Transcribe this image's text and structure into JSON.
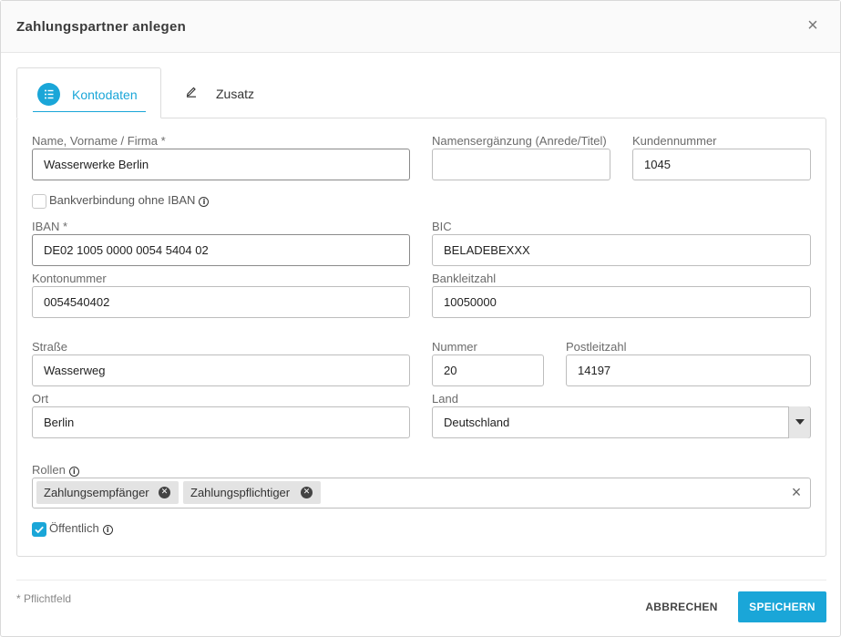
{
  "dialog": {
    "title": "Zahlungspartner anlegen",
    "close_symbol": "×"
  },
  "tabs": [
    {
      "label": "Kontodaten",
      "icon": "list-icon",
      "active": true
    },
    {
      "label": "Zusatz",
      "icon": "pencil-icon",
      "active": false
    }
  ],
  "form": {
    "name": {
      "label": "Name, Vorname / Firma *",
      "value": "Wasserwerke Berlin"
    },
    "name_addition": {
      "label": "Namensergänzung (Anrede/Titel)",
      "value": ""
    },
    "customer_number": {
      "label": "Kundennummer",
      "value": "1045"
    },
    "no_iban": {
      "label": "Bankverbindung ohne IBAN",
      "checked": false
    },
    "iban": {
      "label": "IBAN *",
      "value": "DE02 1005 0000 0054 5404 02"
    },
    "bic": {
      "label": "BIC",
      "value": "BELADEBEXXX"
    },
    "account_number": {
      "label": "Kontonummer",
      "value": "0054540402"
    },
    "bank_code": {
      "label": "Bankleitzahl",
      "value": "10050000"
    },
    "street": {
      "label": "Straße",
      "value": "Wasserweg"
    },
    "house_number": {
      "label": "Nummer",
      "value": "20"
    },
    "postal_code": {
      "label": "Postleitzahl",
      "value": "14197"
    },
    "city": {
      "label": "Ort",
      "value": "Berlin"
    },
    "country": {
      "label": "Land",
      "value": "Deutschland"
    },
    "roles": {
      "label": "Rollen",
      "chips": [
        "Zahlungsempfänger",
        "Zahlungspflichtiger"
      ],
      "clear_symbol": "×"
    },
    "public": {
      "label": "Öffentlich",
      "checked": true
    }
  },
  "footer": {
    "required_note": "* Pflichtfeld",
    "cancel_label": "ABBRECHEN",
    "save_label": "SPEICHERN"
  },
  "colors": {
    "accent": "#1aa6d8"
  }
}
